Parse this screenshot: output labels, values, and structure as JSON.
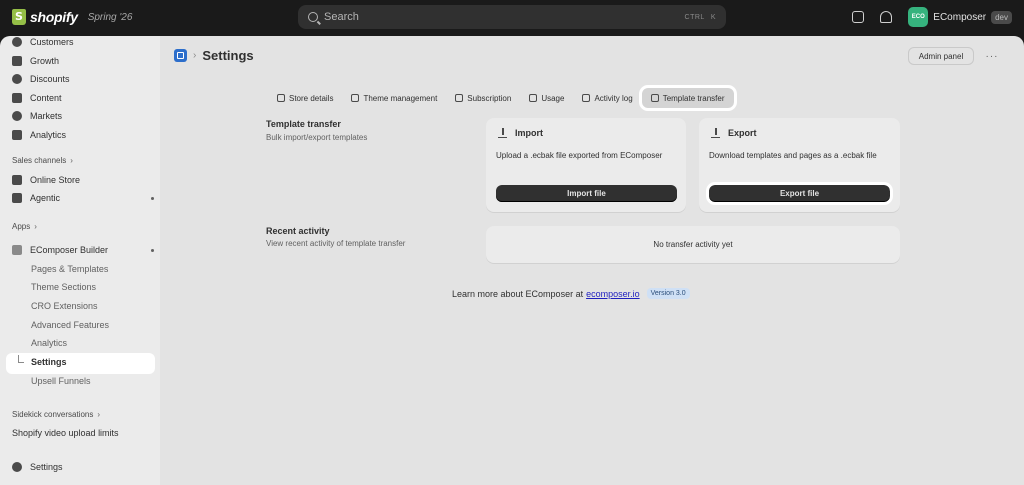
{
  "topbar": {
    "logo_text": "shopify",
    "edition": "Spring '26",
    "search_placeholder": "Search",
    "search_kbd_1": "CTRL",
    "search_kbd_2": "K",
    "store_avatar": "ECO",
    "store_name": "EComposer",
    "store_badge": "dev"
  },
  "sidebar": {
    "items": [
      {
        "label": "Customers",
        "icon": "person-icon"
      },
      {
        "label": "Growth",
        "icon": "growth-icon"
      },
      {
        "label": "Discounts",
        "icon": "discount-icon"
      },
      {
        "label": "Content",
        "icon": "content-icon"
      },
      {
        "label": "Markets",
        "icon": "globe-icon"
      },
      {
        "label": "Analytics",
        "icon": "chart-icon"
      }
    ],
    "sales_channels": "Sales channels",
    "channels": [
      {
        "label": "Online Store",
        "icon": "store-icon"
      },
      {
        "label": "Agentic",
        "icon": "agentic-icon"
      }
    ],
    "apps": "Apps",
    "app_name": "EComposer Builder",
    "app_subitems": [
      "Pages & Templates",
      "Theme Sections",
      "CRO Extensions",
      "Advanced Features",
      "Analytics"
    ],
    "active_item": "Settings",
    "after_active": "Upsell Funnels",
    "sidekick": "Sidekick conversations",
    "video_limits": "Shopify video upload limits",
    "settings": "Settings"
  },
  "main": {
    "title": "Settings",
    "admin_panel": "Admin panel",
    "more": "···",
    "tabs": [
      {
        "label": "Store details",
        "icon": "store-icon"
      },
      {
        "label": "Theme management",
        "icon": "theme-icon"
      },
      {
        "label": "Subscription",
        "icon": "card-icon"
      },
      {
        "label": "Usage",
        "icon": "usage-icon"
      },
      {
        "label": "Activity log",
        "icon": "log-icon"
      },
      {
        "label": "Template transfer",
        "icon": "transfer-icon"
      }
    ],
    "transfer": {
      "title": "Template transfer",
      "subtitle": "Bulk import/export templates"
    },
    "import": {
      "title": "Import",
      "body": "Upload a .ecbak file exported from EComposer",
      "button": "Import file"
    },
    "export": {
      "title": "Export",
      "body": "Download templates and pages as a .ecbak file",
      "button": "Export file"
    },
    "recent": {
      "title": "Recent activity",
      "subtitle": "View recent activity of template transfer",
      "empty": "No transfer activity yet"
    },
    "footer": {
      "text": "Learn more about EComposer at",
      "link": "ecomposer.io",
      "version": "Version 3.0"
    }
  },
  "colors": {
    "accent_green": "#95bf47",
    "link": "#1f1fbf",
    "button_dark": "#303030"
  }
}
